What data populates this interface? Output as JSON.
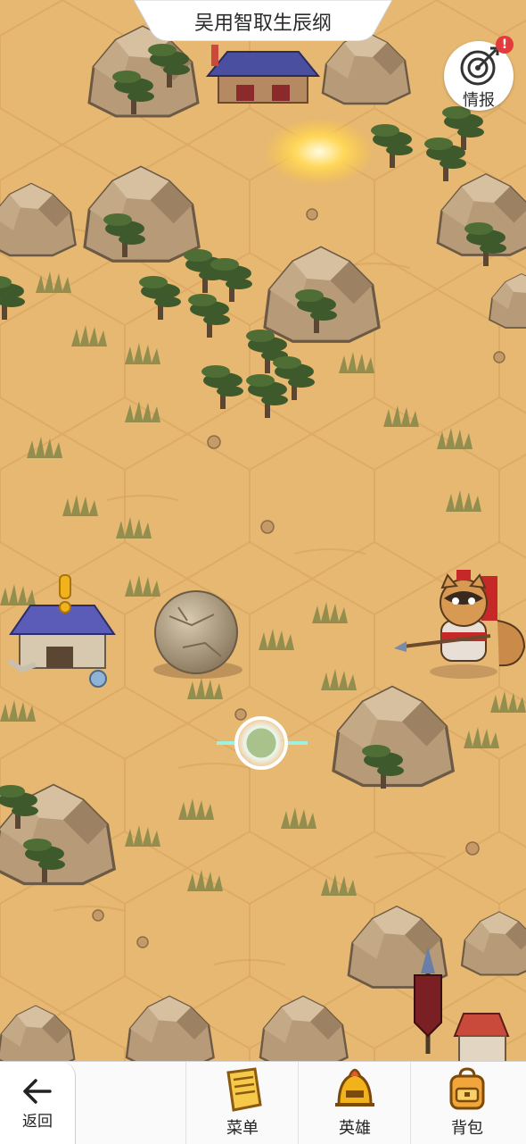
{
  "header": {
    "title": "吴用智取生辰纲"
  },
  "intel": {
    "label": "情报",
    "badge": "!"
  },
  "bottom_bar": {
    "back_label": "返回",
    "menu_label": "菜单",
    "hero_label": "英雄",
    "bag_label": "背包"
  },
  "colors": {
    "sand": "#e6b872",
    "accent_red": "#e33b3b",
    "quest_marker": "#f2b21c"
  }
}
